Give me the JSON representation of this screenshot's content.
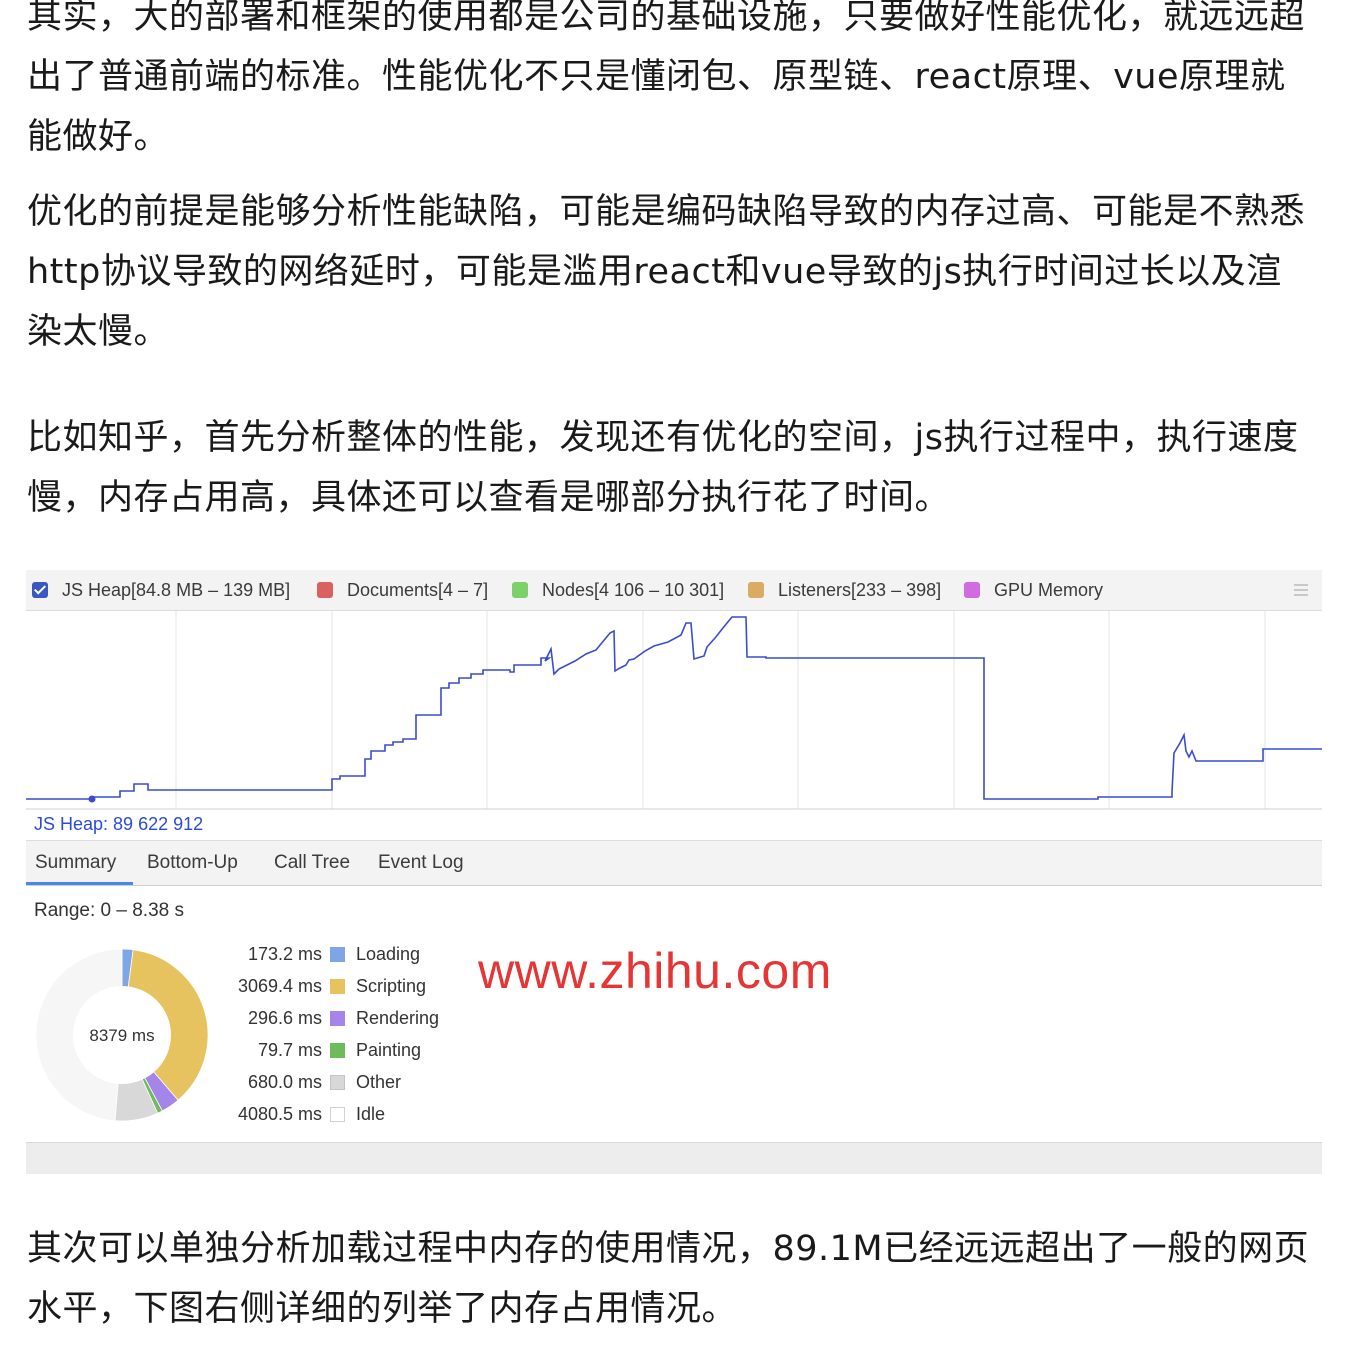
{
  "article": {
    "paragraphs": [
      "其实，大的部署和框架的使用都是公司的基础设施，只要做好性能优化，就远远超出了普通前端的标准。性能优化不只是懂闭包、原型链、react原理、vue原理就能做好。",
      "优化的前提是能够分析性能缺陷，可能是编码缺陷导致的内存过高、可能是不熟悉http协议导致的网络延时，可能是滥用react和vue导致的js执行时间过长以及渲染太慢。",
      "比如知乎，首先分析整体的性能，发现还有优化的空间，js执行过程中，执行速度慢，内存占用高，具体还可以查看是哪部分执行花了时间。",
      "其次可以单独分析加载过程中内存的使用情况，89.1M已经远远超出了一般的网页水平，下图右侧详细的列举了内存占用情况。"
    ]
  },
  "devtools": {
    "legend": [
      {
        "label": "JS Heap[84.8 MB – 139 MB]",
        "color": "#3a57c4",
        "checked": true
      },
      {
        "label": "Documents[4 – 7]",
        "color": "#d9615f",
        "checked": false
      },
      {
        "label": "Nodes[4 106 – 10 301]",
        "color": "#7ed06a",
        "checked": false
      },
      {
        "label": "Listeners[233 – 398]",
        "color": "#d9ab63",
        "checked": false
      },
      {
        "label": "GPU Memory",
        "color": "#d06ce0",
        "checked": false
      }
    ],
    "heap_readout": "JS Heap: 89 622 912",
    "tabs": [
      "Summary",
      "Bottom-Up",
      "Call Tree",
      "Event Log"
    ],
    "active_tab": "Summary",
    "range": "Range: 0 – 8.38 s",
    "total": "8379 ms",
    "breakdown": [
      {
        "value": "173.2 ms",
        "label": "Loading",
        "color": "#7ea6e6",
        "ms": 173.2
      },
      {
        "value": "3069.4 ms",
        "label": "Scripting",
        "color": "#e7c35f",
        "ms": 3069.4
      },
      {
        "value": "296.6 ms",
        "label": "Rendering",
        "color": "#a585ea",
        "ms": 296.6
      },
      {
        "value": "79.7 ms",
        "label": "Painting",
        "color": "#6dbb5b",
        "ms": 79.7
      },
      {
        "value": "680.0 ms",
        "label": "Other",
        "color": "#d8d8d8",
        "ms": 680.0
      },
      {
        "value": "4080.5 ms",
        "label": "Idle",
        "color": "#f6f6f6",
        "ms": 4080.5
      }
    ]
  },
  "watermark": "www.zhihu.com"
}
